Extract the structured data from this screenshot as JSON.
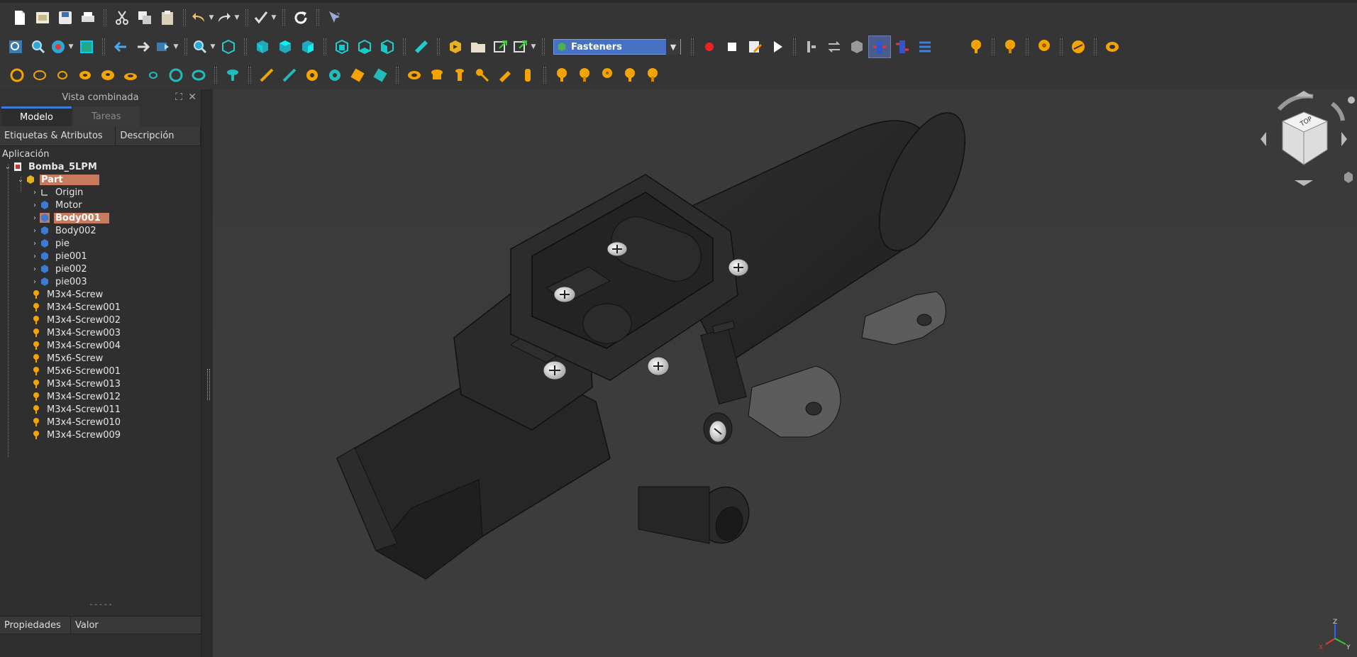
{
  "toolbar": {
    "workbench_label": "Fasteners"
  },
  "combo_view": {
    "title": "Vista combinada",
    "tabs": [
      "Modelo",
      "Tareas"
    ],
    "columns": [
      "Etiquetas & Atributos",
      "Descripción"
    ],
    "app_label": "Aplicación",
    "document": "Bomba_5LPM",
    "part": "Part",
    "part_children": [
      "Origin",
      "Motor",
      "Body001",
      "Body002",
      "pie",
      "pie001",
      "pie002",
      "pie003"
    ],
    "screws": [
      "M3x4-Screw",
      "M3x4-Screw001",
      "M3x4-Screw002",
      "M3x4-Screw003",
      "M3x4-Screw004",
      "M5x6-Screw",
      "M5x6-Screw001",
      "M3x4-Screw013",
      "M3x4-Screw012",
      "M3x4-Screw011",
      "M3x4-Screw010",
      "M3x4-Screw009"
    ]
  },
  "properties": {
    "columns": [
      "Propiedades",
      "Valor"
    ]
  },
  "navcube": {
    "face_label": "TOP"
  },
  "axis": {
    "x": "X",
    "y": "Y",
    "z": "Z"
  },
  "colors": {
    "selection": "#c97a5e",
    "workbench_select": "#4772c4",
    "fastener_icon": "#f5a300"
  }
}
